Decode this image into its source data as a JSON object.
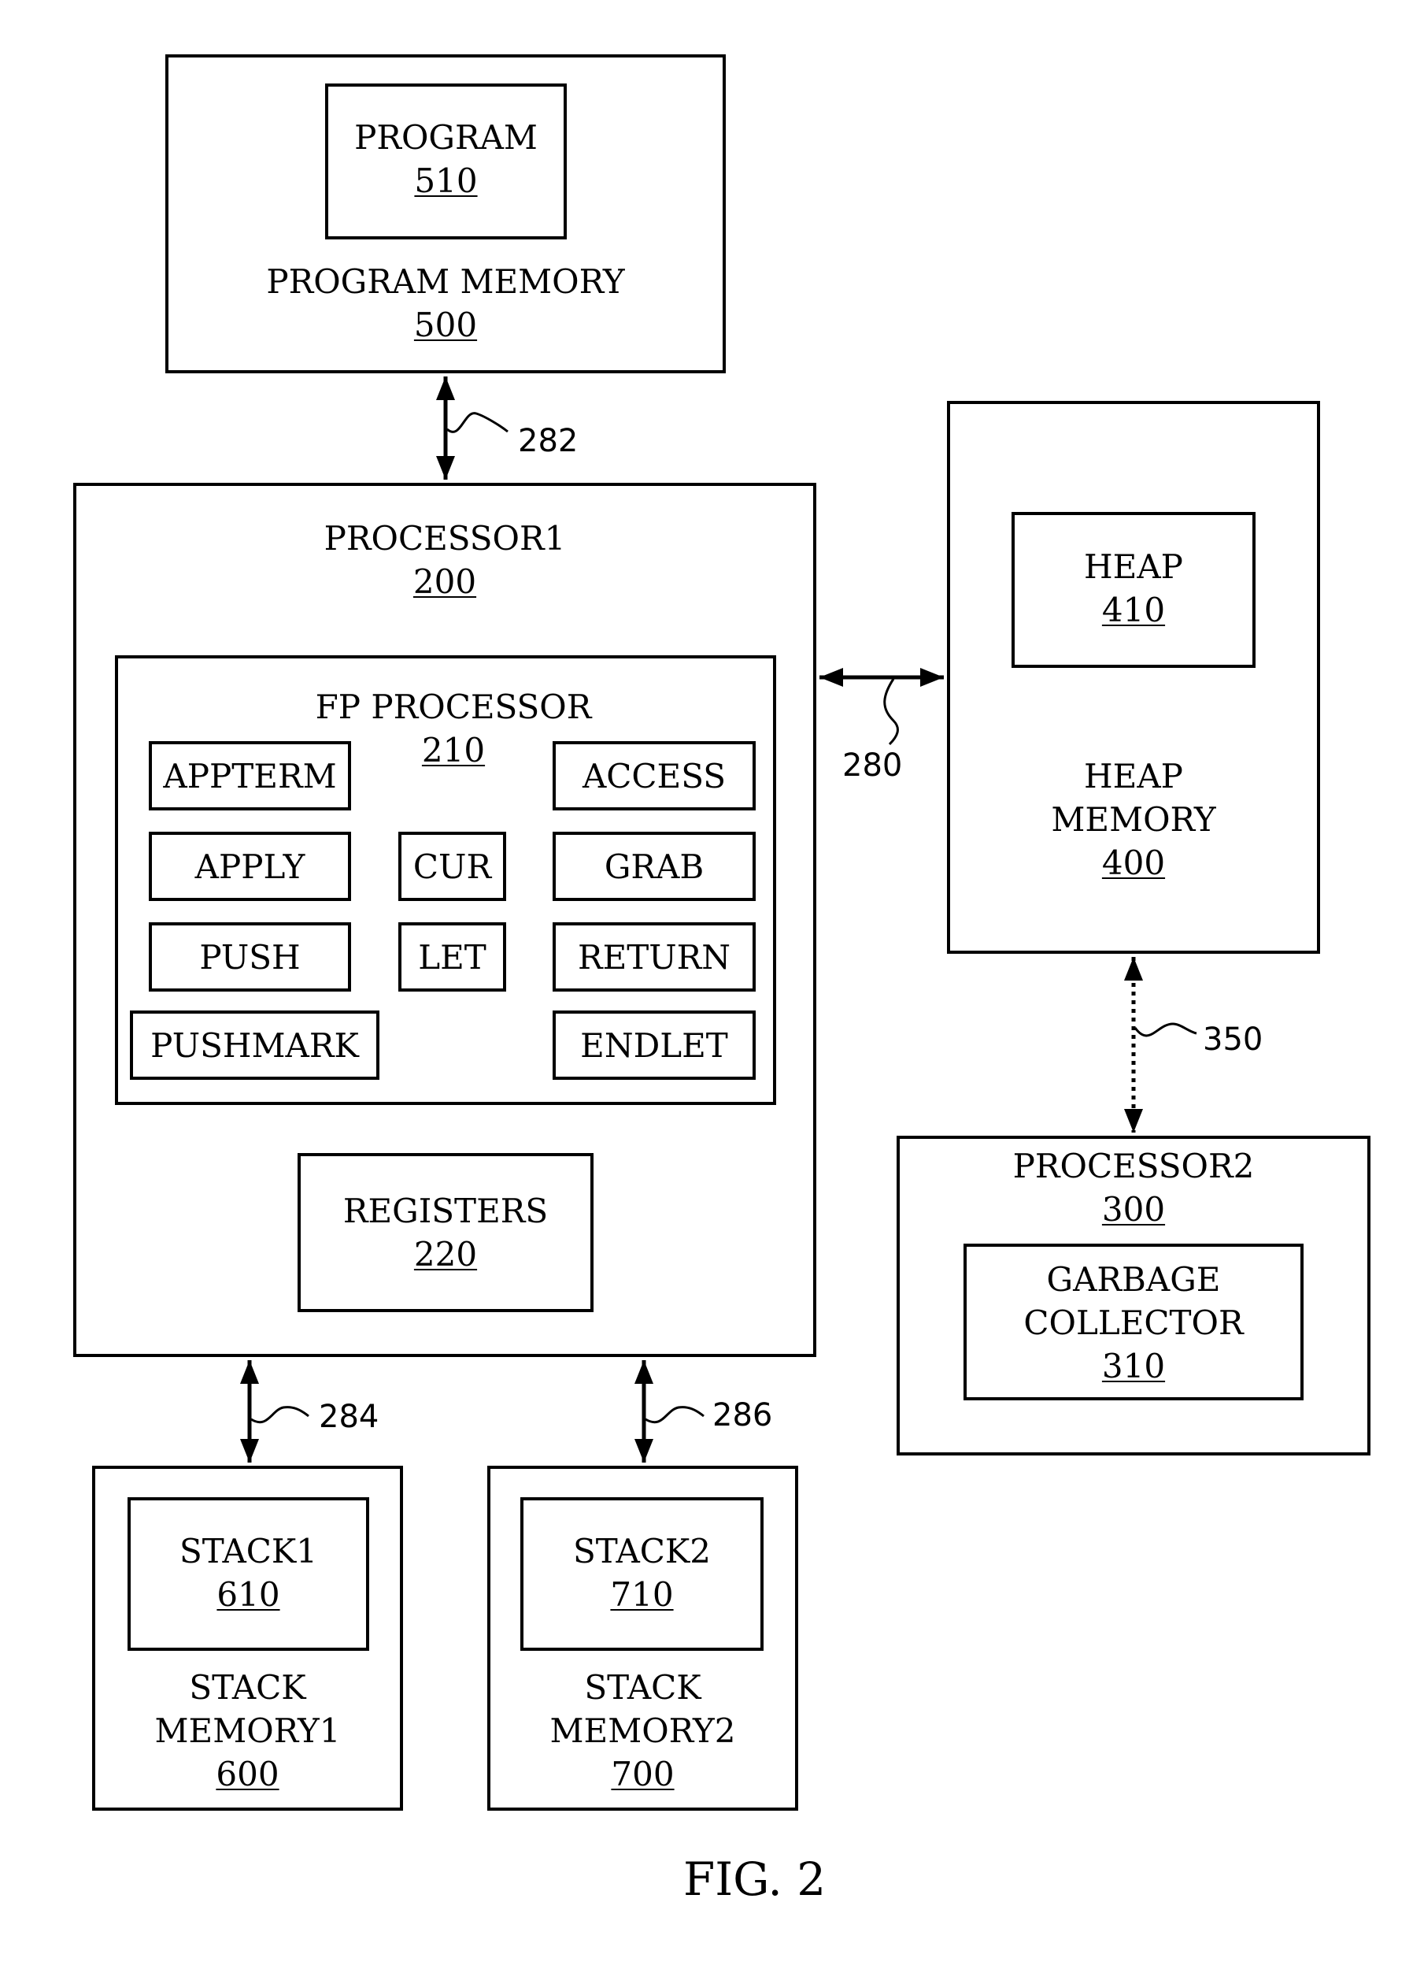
{
  "figure": {
    "caption": "FIG. 2"
  },
  "program_memory": {
    "title": "PROGRAM MEMORY",
    "ref": "500",
    "program": {
      "title": "PROGRAM",
      "ref": "510"
    }
  },
  "processor1": {
    "title": "PROCESSOR1",
    "ref": "200",
    "fp_processor": {
      "title": "FP PROCESSOR",
      "ref": "210",
      "instructions": [
        "APPTERM",
        "ACCESS",
        "APPLY",
        "CUR",
        "GRAB",
        "PUSH",
        "LET",
        "RETURN",
        "PUSHMARK",
        "ENDLET"
      ]
    },
    "registers": {
      "title": "REGISTERS",
      "ref": "220"
    }
  },
  "heap_memory": {
    "title_line1": "HEAP",
    "title_line2": "MEMORY",
    "ref": "400",
    "heap": {
      "title": "HEAP",
      "ref": "410"
    }
  },
  "processor2": {
    "title": "PROCESSOR2",
    "ref": "300",
    "garbage_collector": {
      "title_line1": "GARBAGE",
      "title_line2": "COLLECTOR",
      "ref": "310"
    }
  },
  "stack_memory1": {
    "title_line1": "STACK",
    "title_line2": "MEMORY1",
    "ref": "600",
    "stack": {
      "title": "STACK1",
      "ref": "610"
    }
  },
  "stack_memory2": {
    "title_line1": "STACK",
    "title_line2": "MEMORY2",
    "ref": "700",
    "stack": {
      "title": "STACK2",
      "ref": "710"
    }
  },
  "connections": [
    {
      "ref": "282",
      "from": "PROGRAM MEMORY 500",
      "to": "PROCESSOR1 200",
      "style": "solid",
      "direction": "bidirectional"
    },
    {
      "ref": "280",
      "from": "PROCESSOR1 200",
      "to": "HEAP MEMORY 400",
      "style": "solid",
      "direction": "bidirectional"
    },
    {
      "ref": "350",
      "from": "HEAP MEMORY 400",
      "to": "PROCESSOR2 300",
      "style": "dotted",
      "direction": "bidirectional"
    },
    {
      "ref": "284",
      "from": "PROCESSOR1 200",
      "to": "STACK MEMORY1 600",
      "style": "solid",
      "direction": "bidirectional"
    },
    {
      "ref": "286",
      "from": "PROCESSOR1 200",
      "to": "STACK MEMORY2 700",
      "style": "solid",
      "direction": "bidirectional"
    }
  ]
}
